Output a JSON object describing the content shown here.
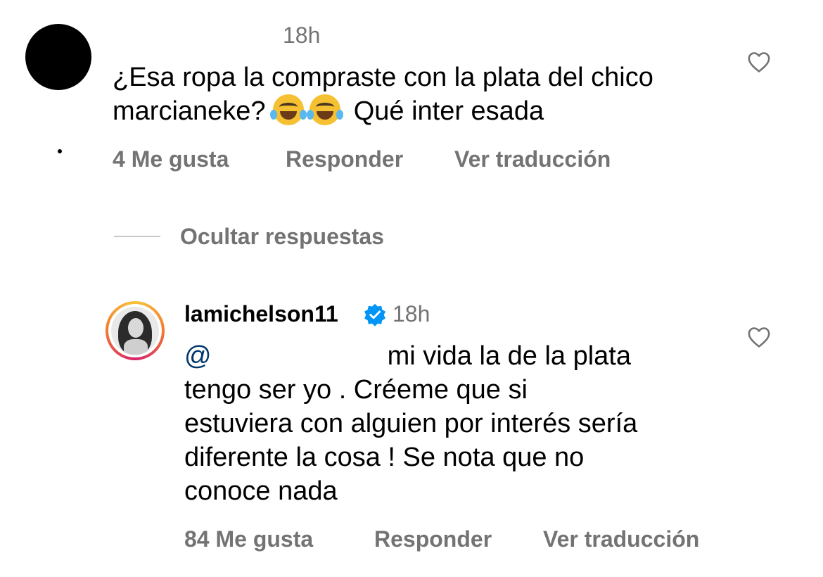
{
  "comment": {
    "time": "18h",
    "text_before_emoji": "¿Esa ropa la compraste con la plata del chico marcianeke?",
    "text_after_emoji": "Qué inter esada",
    "likes_label": "4 Me gusta",
    "reply_label": "Responder",
    "translate_label": "Ver traducción"
  },
  "toggle": {
    "label": "Ocultar respuestas"
  },
  "reply": {
    "username": "lamichelson11",
    "time": "18h",
    "mention_prefix": "@",
    "text_first": "mi vida la de la plata",
    "text_rest": "tengo ser yo . Créeme que si\nestuviera con alguien por interés sería\ndiferente la cosa ! Se nota que no\nconoce nada",
    "likes_label": "84 Me gusta",
    "reply_label": "Responder",
    "translate_label": "Ver traducción"
  },
  "colors": {
    "secondary_text": "#737373",
    "verified_blue": "#0095f6",
    "mention": "#00376b"
  },
  "icons": [
    "heart-outline-icon",
    "verified-badge-icon",
    "face-with-tears-of-joy-emoji"
  ]
}
